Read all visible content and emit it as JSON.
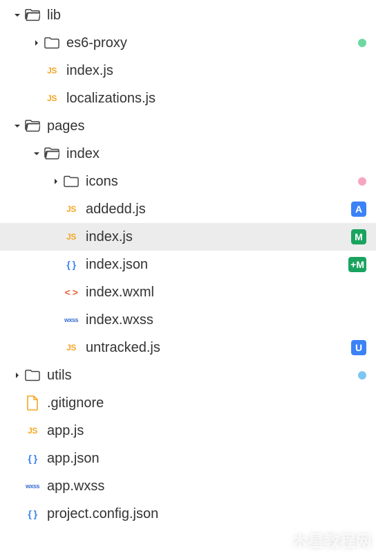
{
  "layout": {
    "indent_base": 18,
    "indent_step": 28,
    "arrow_slot": 18
  },
  "icons": {
    "js": {
      "text": "JS",
      "color": "#f5a623",
      "weight": 800,
      "size": 12
    },
    "json": {
      "text": "{ }",
      "color": "#3b82f6",
      "weight": 700,
      "size": 14
    },
    "wxml": {
      "text": "< >",
      "color": "#e8633d",
      "weight": 700,
      "size": 14
    },
    "wxss": {
      "text": "wxss",
      "color": "#3b6fd3",
      "weight": 700,
      "size": 9
    }
  },
  "status_styles": {
    "dot-green": {
      "kind": "dot",
      "color": "#6dd8a0"
    },
    "dot-pink": {
      "kind": "dot",
      "color": "#f6a6c2"
    },
    "dot-blue": {
      "kind": "dot",
      "color": "#7cc6f2"
    },
    "A": {
      "kind": "badge",
      "bg": "#3b82f6",
      "text": "A"
    },
    "M": {
      "kind": "badge",
      "bg": "#1aa35f",
      "text": "M"
    },
    "plusM": {
      "kind": "badge",
      "bg": "#1aa35f",
      "text": "+M"
    },
    "U": {
      "kind": "badge",
      "bg": "#3b82f6",
      "text": "U"
    }
  },
  "rows": [
    {
      "depth": 0,
      "arrow": "down",
      "icon": "folder-open",
      "label": "lib"
    },
    {
      "depth": 1,
      "arrow": "right",
      "icon": "folder",
      "label": "es6-proxy",
      "status": "dot-green"
    },
    {
      "depth": 1,
      "arrow": "none",
      "icon": "js",
      "label": "index.js"
    },
    {
      "depth": 1,
      "arrow": "none",
      "icon": "js",
      "label": "localizations.js"
    },
    {
      "depth": 0,
      "arrow": "down",
      "icon": "folder-open",
      "label": "pages"
    },
    {
      "depth": 1,
      "arrow": "down",
      "icon": "folder-open",
      "label": "index"
    },
    {
      "depth": 2,
      "arrow": "right",
      "icon": "folder",
      "label": "icons",
      "status": "dot-pink"
    },
    {
      "depth": 2,
      "arrow": "none",
      "icon": "js",
      "label": "addedd.js",
      "status": "A"
    },
    {
      "depth": 2,
      "arrow": "none",
      "icon": "js",
      "label": "index.js",
      "status": "M",
      "selected": true
    },
    {
      "depth": 2,
      "arrow": "none",
      "icon": "json",
      "label": "index.json",
      "status": "plusM"
    },
    {
      "depth": 2,
      "arrow": "none",
      "icon": "wxml",
      "label": "index.wxml"
    },
    {
      "depth": 2,
      "arrow": "none",
      "icon": "wxss",
      "label": "index.wxss"
    },
    {
      "depth": 2,
      "arrow": "none",
      "icon": "js",
      "label": "untracked.js",
      "status": "U"
    },
    {
      "depth": 0,
      "arrow": "right",
      "icon": "folder",
      "label": "utils",
      "status": "dot-blue"
    },
    {
      "depth": 0,
      "arrow": "none",
      "icon": "file",
      "label": ".gitignore"
    },
    {
      "depth": 0,
      "arrow": "none",
      "icon": "js",
      "label": "app.js"
    },
    {
      "depth": 0,
      "arrow": "none",
      "icon": "json",
      "label": "app.json"
    },
    {
      "depth": 0,
      "arrow": "none",
      "icon": "wxss",
      "label": "app.wxss"
    },
    {
      "depth": 0,
      "arrow": "none",
      "icon": "json",
      "label": "project.config.json"
    }
  ],
  "watermark": "木星教程网"
}
